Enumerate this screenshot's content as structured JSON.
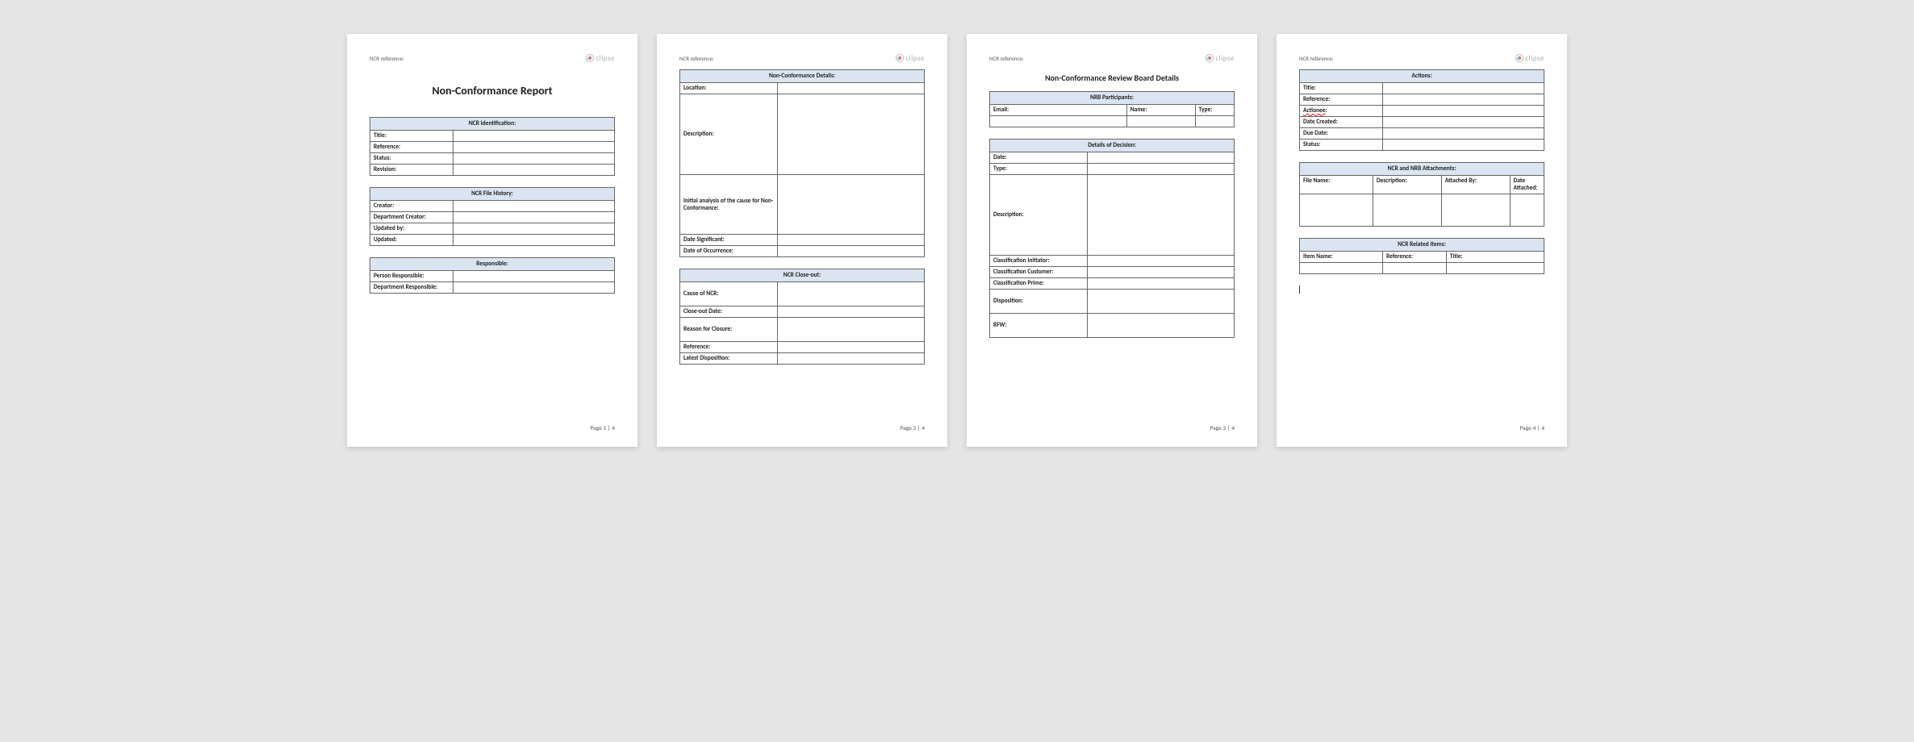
{
  "common": {
    "ncr_ref_label": "NCR reference:",
    "logo_text": "clipse"
  },
  "footer": {
    "p1": "Page 1 | 4",
    "p2": "Page 2 | 4",
    "p3": "Page 3 | 4",
    "p4": "Page 4 | 4"
  },
  "p1": {
    "title": "Non-Conformance Report",
    "ident_hdr": "NCR Identification:",
    "ident": {
      "title": "Title:",
      "reference": "Reference:",
      "status": "Status:",
      "revision": "Revision:"
    },
    "hist_hdr": "NCR File History:",
    "hist": {
      "creator": "Creator:",
      "dept_creator": "Department Creator:",
      "updated_by": "Updated by:",
      "updated": "Updated:"
    },
    "resp_hdr": "Responsible:",
    "resp": {
      "person": "Person Responsible:",
      "dept": "Department Responsible:"
    }
  },
  "p2": {
    "details_hdr": "Non-Conformance Details:",
    "details": {
      "location": "Location:",
      "description": "Description:",
      "analysis": "Initial analysis of the cause for Non-Conformance:",
      "date_sig": "Date Significant:",
      "date_occ": "Date of Occurrence:"
    },
    "closeout_hdr": "NCR Close-out:",
    "closeout": {
      "cause": "Cause of NCR:",
      "date": "Close-out Date:",
      "reason": "Reason for Closure:",
      "reference": "Reference:",
      "latest": "Latest Disposition:"
    }
  },
  "p3": {
    "title": "Non-Conformance Review Board Details",
    "parts_hdr": "NRB Participants:",
    "parts": {
      "email": "Email:",
      "name": "Name:",
      "type": "Type:"
    },
    "dec_hdr": "Details of Decision:",
    "dec": {
      "date": "Date:",
      "type": "Type:",
      "description": "Description:",
      "class_init": "Classification Initiator:",
      "class_cust": "Classification Customer:",
      "class_prime": "Classification Prime:",
      "disposition": "Disposition:",
      "rfw": "RFW:"
    }
  },
  "p4": {
    "actions_hdr": "Actions:",
    "actions": {
      "title": "Title:",
      "reference": "Reference:",
      "actionee": "Actionee",
      "actionee_colon": ":",
      "date_created": "Date Created:",
      "due_date": "Due Date:",
      "status": "Status:"
    },
    "att_hdr": "NCR and NRB Attachments:",
    "att": {
      "file": "File Name:",
      "desc": "Description:",
      "by": "Attached By:",
      "date": "Date Attached:"
    },
    "rel_hdr": "NCR Related Items:",
    "rel": {
      "item": "Item Name:",
      "ref": "Reference:",
      "title": "Title:"
    }
  }
}
